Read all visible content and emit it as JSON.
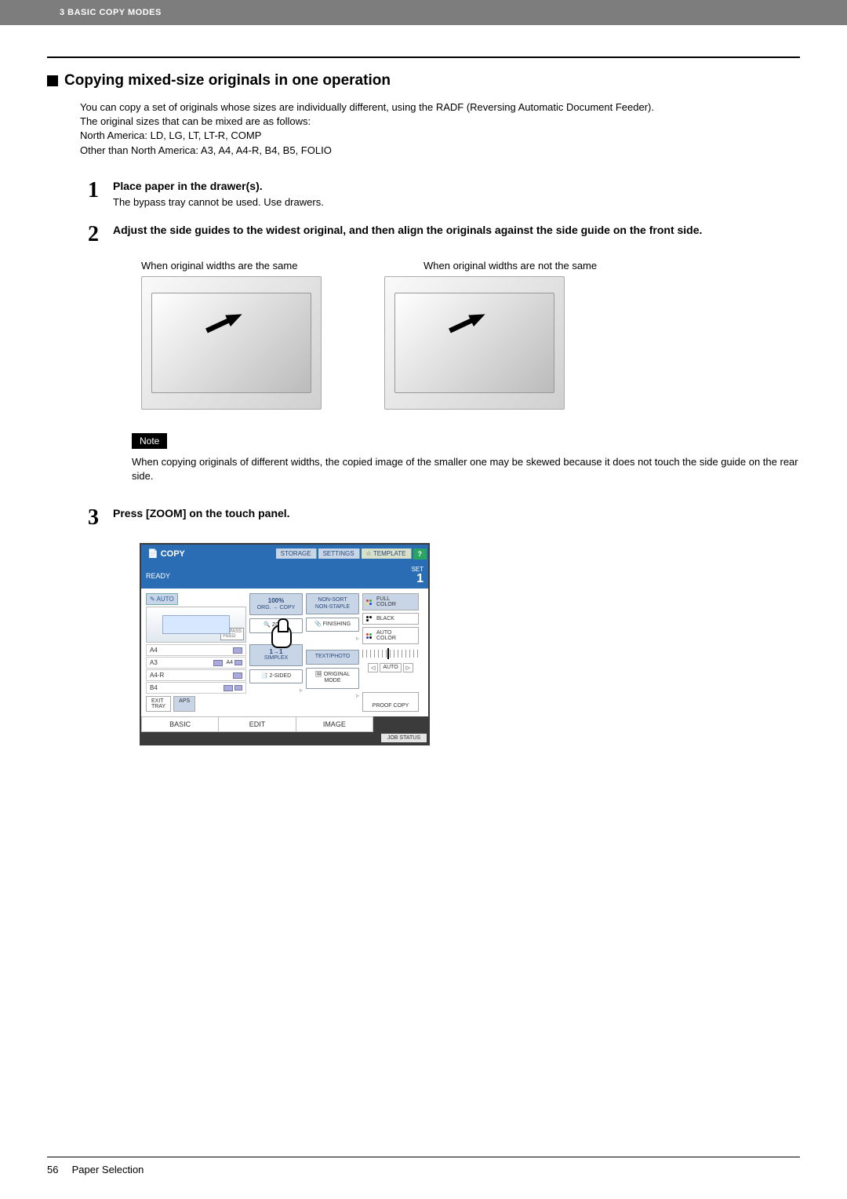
{
  "header": {
    "breadcrumb": "3 BASIC COPY MODES"
  },
  "section": {
    "title": "Copying mixed-size originals in one operation",
    "intro_l1": "You can copy a set of originals whose sizes are individually different, using the RADF (Reversing Automatic Document Feeder).",
    "intro_l2": "The original sizes that can be mixed are as follows:",
    "intro_l3": "North America: LD, LG, LT, LT-R, COMP",
    "intro_l4": "Other than North America: A3, A4, A4-R, B4, B5, FOLIO"
  },
  "steps": {
    "s1": {
      "num": "1",
      "heading": "Place paper in the drawer(s).",
      "text": "The bypass tray cannot be used. Use drawers."
    },
    "s2": {
      "num": "2",
      "heading": "Adjust the side guides to the widest original, and then align the originals against the side guide on the front side.",
      "cap_left": "When original widths are the same",
      "cap_right": "When original widths are not the same"
    },
    "s3": {
      "num": "3",
      "heading": "Press [ZOOM] on the touch panel."
    }
  },
  "note": {
    "badge": "Note",
    "text": "When copying originals of different widths, the copied image of the smaller one may be skewed because it does not touch the side guide on the rear side."
  },
  "panel": {
    "copy": "COPY",
    "tabs": {
      "storage": "STORAGE",
      "settings": "SETTINGS",
      "template": "TEMPLATE",
      "help": "?"
    },
    "status": "READY",
    "set_label": "SET",
    "set_count": "1",
    "auto": "AUTO",
    "bypass": "BYPASS\nFEED",
    "trays": [
      {
        "size": "A4",
        "extra": ""
      },
      {
        "size": "A3",
        "extra": "A4"
      },
      {
        "size": "A4-R",
        "extra": ""
      },
      {
        "size": "B4",
        "extra": ""
      }
    ],
    "exit_tray": "EXIT\nTRAY",
    "aps": "APS",
    "zoom_pct": "100%",
    "zoom_sub": "ORG. → COPY",
    "zoom_btn": "ZOOM",
    "simplex_top": "1→1",
    "simplex": "SIMPLEX",
    "twosided": "2-SIDED",
    "nonsort": "NON-SORT\nNON-STAPLE",
    "finishing": "FINISHING",
    "textphoto": "TEXT/PHOTO",
    "original_mode": "ORIGINAL\nMODE",
    "color_modes": {
      "full": "FULL\nCOLOR",
      "black": "BLACK",
      "auto": "AUTO\nCOLOR"
    },
    "density_auto": "AUTO",
    "proof": "PROOF COPY",
    "bottom_tabs": {
      "basic": "BASIC",
      "edit": "EDIT",
      "image": "IMAGE"
    },
    "job_status": "JOB STATUS"
  },
  "footer": {
    "page": "56",
    "title": "Paper Selection"
  }
}
